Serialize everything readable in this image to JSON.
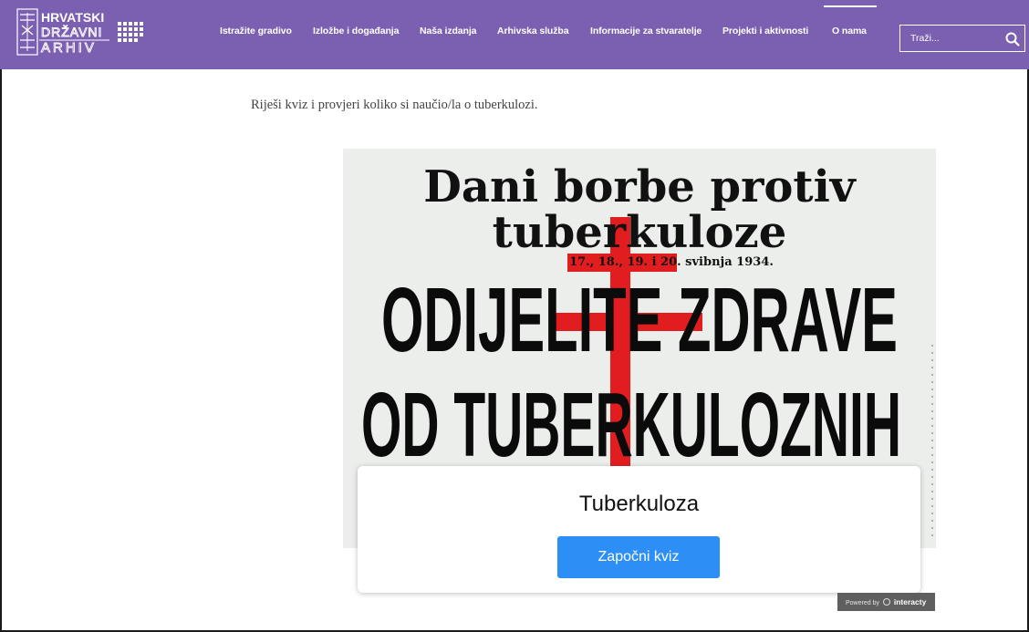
{
  "header": {
    "logo": {
      "line1": "HRVATSKI",
      "line2": "DRŽAVNI",
      "line3": "ARHIV"
    },
    "nav": [
      {
        "label": "Istražite gradivo"
      },
      {
        "label": "Izložbe i događanja"
      },
      {
        "label": "Naša izdanja"
      },
      {
        "label": "Arhivska služba"
      },
      {
        "label": "Informacije za stvaratelje"
      },
      {
        "label": "Projekti i aktivnosti"
      },
      {
        "label": "O nama"
      }
    ],
    "search": {
      "placeholder": "Traži..."
    },
    "background_color": "#7b5fb0"
  },
  "main": {
    "intro_text": "Riješi kviz i provjeri koliko si naučio/la o tuberkulozi.",
    "poster": {
      "line1": "Dani borbe protiv",
      "line2": "tuberkuloze",
      "dates": "17., 18., 19. i 20. svibnja 1934.",
      "line3": "ODIJELITE ZDRAVE",
      "line4": "OD TUBERKULOZNIH"
    },
    "quiz": {
      "title": "Tuberkuloza",
      "start_label": "Započni kviz",
      "button_color": "#2d8ff5"
    },
    "powered_by": {
      "prefix": "Powered by",
      "brand": "interacty"
    }
  }
}
